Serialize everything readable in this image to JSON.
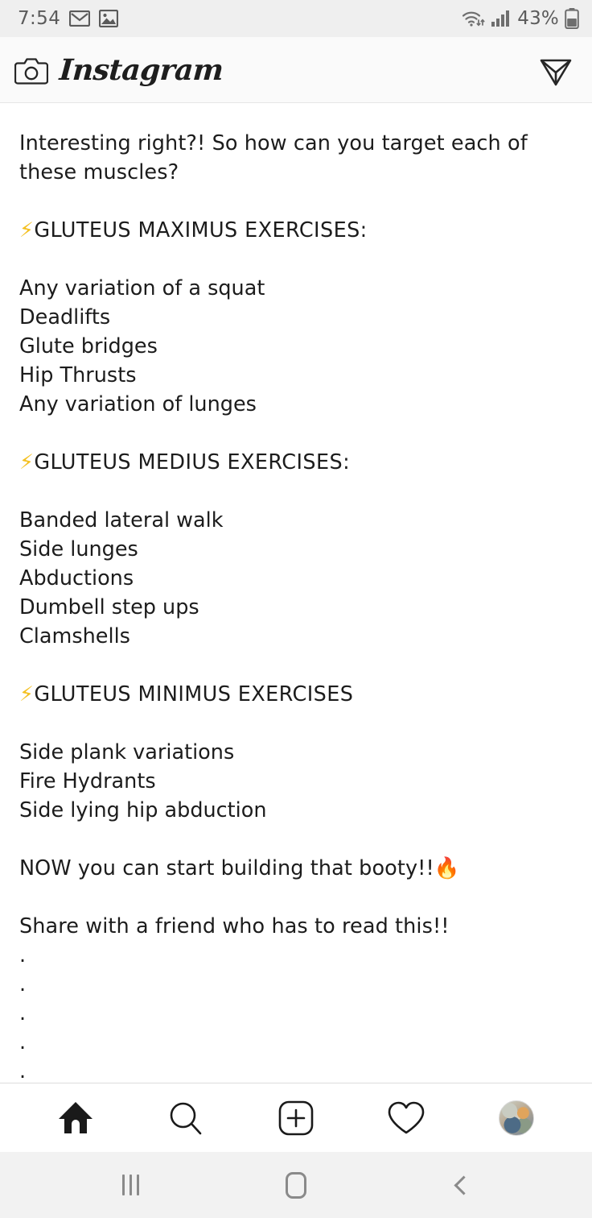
{
  "status_bar": {
    "time": "7:54",
    "left_icons": [
      "gmail-icon",
      "photos-icon"
    ],
    "wifi_icon": "wifi-icon",
    "signal_icon": "cellular-signal-icon",
    "battery_percent": "43%",
    "battery_icon": "battery-icon",
    "background_color": "#efefef",
    "text_color": "#5b5b5b"
  },
  "app_header": {
    "camera_icon": "camera-icon",
    "title": "Instagram",
    "direct_message_icon": "paper-plane-icon",
    "background_color": "#fafafa"
  },
  "post": {
    "caption_intro": "Interesting right?! So how can you target each of these muscles?",
    "sections": [
      {
        "bolt": "⚡",
        "heading": "GLUTEUS MAXIMUS EXERCISES:",
        "exercises": [
          "Any variation of a squat",
          "Deadlifts",
          "Glute bridges",
          "Hip Thrusts",
          "Any variation of lunges"
        ]
      },
      {
        "bolt": "⚡",
        "heading": "GLUTEUS MEDIUS EXERCISES:",
        "exercises": [
          "Banded lateral walk",
          "Side lunges",
          "Abductions",
          "Dumbell step ups",
          "Clamshells"
        ]
      },
      {
        "bolt": "⚡",
        "heading": "GLUTEUS MINIMUS EXERCISES",
        "exercises": [
          "Side plank variations",
          "Fire Hydrants",
          "Side lying hip abduction"
        ]
      }
    ],
    "closing_line": "NOW you can start building that booty!!",
    "closing_emoji": "🔥",
    "share_line": "Share with a friend who has to read this!!",
    "trailing_dots": [
      ".",
      ".",
      ".",
      ".",
      "."
    ],
    "text_color": "#1c1c1c",
    "bolt_color": "#f4c020"
  },
  "tab_bar": {
    "tabs": [
      {
        "name": "home",
        "icon": "home-icon",
        "active": true
      },
      {
        "name": "search",
        "icon": "search-icon",
        "active": false
      },
      {
        "name": "create",
        "icon": "plus-square-icon",
        "active": false
      },
      {
        "name": "activity",
        "icon": "heart-icon",
        "active": false
      },
      {
        "name": "profile",
        "icon": "avatar-icon",
        "active": false
      }
    ]
  },
  "system_nav": {
    "recents_label": "recents-icon",
    "home_label": "home-icon",
    "back_label": "back-icon",
    "background_color": "#f2f2f2",
    "icon_color": "#8a8a8a"
  }
}
